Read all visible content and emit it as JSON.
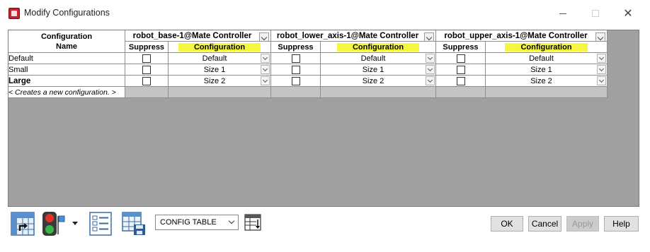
{
  "window": {
    "title": "Modify Configurations",
    "minimize_icon": "minimize-icon",
    "maximize_icon": "maximize-icon",
    "close_glyph": "✕"
  },
  "table": {
    "name_header": "Configuration Name",
    "components": [
      {
        "name": "robot_base-1@Mate Controller",
        "suppress_label": "Suppress",
        "config_label": "Configuration"
      },
      {
        "name": "robot_lower_axis-1@Mate Controller",
        "suppress_label": "Suppress",
        "config_label": "Configuration"
      },
      {
        "name": "robot_upper_axis-1@Mate Controller",
        "suppress_label": "Suppress",
        "config_label": "Configuration"
      }
    ],
    "rows": [
      {
        "name": "Default",
        "values": [
          "Default",
          "Default",
          "Default"
        ],
        "suppressed": [
          false,
          false,
          false
        ]
      },
      {
        "name": "Small",
        "values": [
          "Size 1",
          "Size 1",
          "Size 1"
        ],
        "suppressed": [
          false,
          false,
          false
        ]
      },
      {
        "name": "Large",
        "values": [
          "Size 2",
          "Size 2",
          "Size 2"
        ],
        "suppressed": [
          false,
          false,
          false
        ]
      }
    ],
    "new_row": "< Creates a new configuration. >",
    "highlight_color": "#f6f640"
  },
  "toolbar": {
    "select_value": "CONFIG TABLE",
    "icons": [
      "table-link-icon",
      "traffic-light-icon",
      "list-view-icon",
      "save-table-icon",
      "column-settings-icon"
    ]
  },
  "buttons": {
    "ok": "OK",
    "cancel": "Cancel",
    "apply": "Apply",
    "help": "Help"
  }
}
